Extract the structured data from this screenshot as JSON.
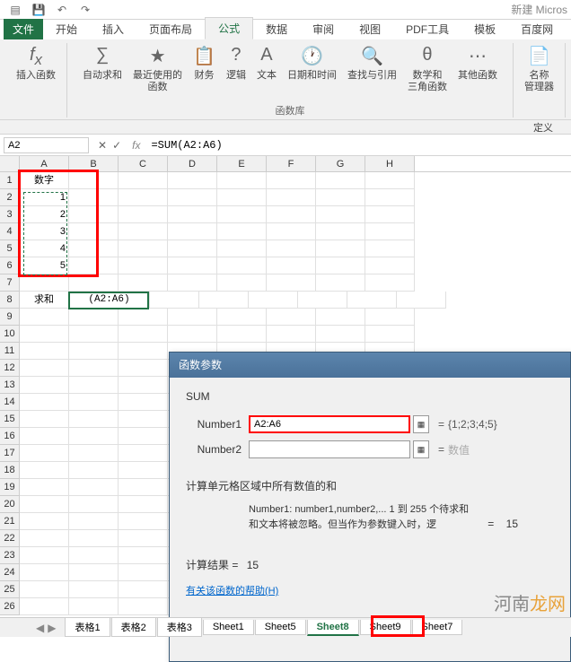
{
  "title": "新建 Micros",
  "qat": {
    "save": "💾",
    "undo": "↶",
    "redo": "↷"
  },
  "tabs": {
    "file": "文件",
    "items": [
      "开始",
      "插入",
      "页面布局",
      "公式",
      "数据",
      "审阅",
      "视图",
      "PDF工具",
      "模板",
      "百度网"
    ],
    "active": "公式"
  },
  "ribbon": {
    "insert_fn": "插入函数",
    "autosum": "自动求和",
    "recent": "最近使用的\n函数",
    "financial": "财务",
    "logical": "逻辑",
    "text": "文本",
    "datetime": "日期和时间",
    "lookup": "查找与引用",
    "math": "数学和\n三角函数",
    "other": "其他函数",
    "name_mgr": "名称\n管理器",
    "group_lib": "函数库",
    "define": "定义"
  },
  "formula_bar": {
    "name_box": "A2",
    "formula": "=SUM(A2:A6)"
  },
  "columns": [
    "A",
    "B",
    "C",
    "D",
    "E",
    "F",
    "G",
    "H"
  ],
  "rows_count": 26,
  "cells": {
    "A1": "数字",
    "A2": "1",
    "A3": "2",
    "A4": "3",
    "A5": "4",
    "A6": "5",
    "A8": "求和",
    "B8": "(A2:A6)"
  },
  "dialog": {
    "title": "函数参数",
    "fn_name": "SUM",
    "arg1_label": "Number1",
    "arg1_value": "A2:A6",
    "arg1_result": "{1;2;3;4;5}",
    "arg2_label": "Number2",
    "arg2_value": "",
    "arg2_result": "数值",
    "result_label": "=",
    "result_value": "15",
    "description": "计算单元格区域中所有数值的和",
    "param_desc": "Number1:  number1,number2,...  1 到 255 个待求和\n和文本将被忽略。但当作为参数键入时，逻",
    "calc_label": "计算结果 =",
    "calc_value": "15",
    "help_link": "有关该函数的帮助(H)"
  },
  "sheet_tabs": {
    "items": [
      "表格1",
      "表格2",
      "表格3",
      "Sheet1",
      "Sheet5",
      "Sheet8",
      "Sheet9",
      "Sheet7"
    ],
    "active": "Sheet8"
  },
  "watermark": {
    "part1": "河南",
    "part2": "龙网"
  },
  "chart_data": {
    "type": "table",
    "title": "数字",
    "categories": [
      "A2",
      "A3",
      "A4",
      "A5",
      "A6"
    ],
    "values": [
      1,
      2,
      3,
      4,
      5
    ],
    "sum": 15
  }
}
